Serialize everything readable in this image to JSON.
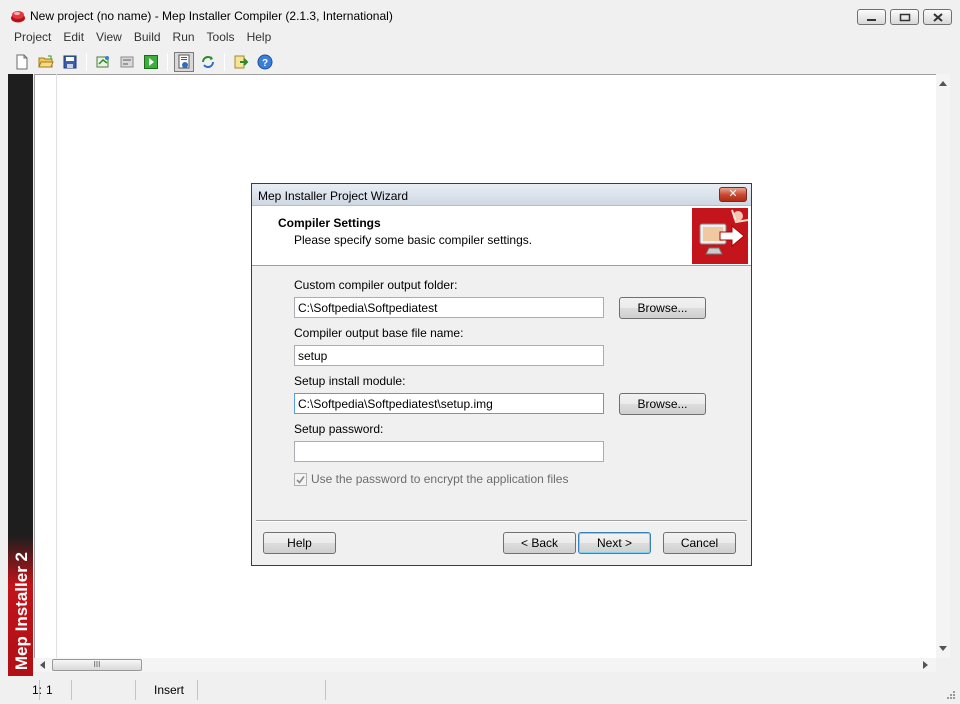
{
  "window": {
    "title": "New project (no name) - Mep Installer Compiler (2.1.3, International)"
  },
  "menubar": {
    "items": [
      "Project",
      "Edit",
      "View",
      "Build",
      "Run",
      "Tools",
      "Help"
    ]
  },
  "toolbar": {
    "icons": [
      "new-file-icon",
      "open-folder-icon",
      "save-icon",
      "project-wizard-icon",
      "compile-icon",
      "run-icon",
      "settings-icon",
      "refresh-icon",
      "export-icon",
      "help-icon"
    ]
  },
  "side_banner": {
    "text": "Mep Installer 2"
  },
  "scrollbar": {
    "thumb_grip": "III"
  },
  "statusbar": {
    "line": "1:",
    "column": "1",
    "mode": "Insert"
  },
  "dialog": {
    "title": "Mep Installer Project Wizard",
    "close_label": "✕",
    "header_title": "Compiler Settings",
    "header_subtitle": "Please specify some basic compiler settings.",
    "output_folder_label": "Custom compiler output folder:",
    "output_folder_value": "C:\\Softpedia\\Softpediatest",
    "base_name_label": "Compiler output base file name:",
    "base_name_value": "setup",
    "install_module_label": "Setup install module:",
    "install_module_value": "C:\\Softpedia\\Softpediatest\\setup.img",
    "password_label": "Setup password:",
    "password_value": "",
    "encrypt_label": "Use the password to encrypt the application files",
    "encrypt_checked": true,
    "browse_label": "Browse...",
    "help_label": "Help",
    "back_label": "< Back",
    "next_label": "Next >",
    "cancel_label": "Cancel"
  }
}
